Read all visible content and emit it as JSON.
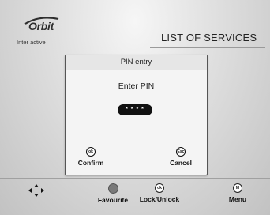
{
  "logo": {
    "name": "Orbit",
    "subtitle": "Inter active"
  },
  "screen_title": "LIST OF SERVICES",
  "dialog": {
    "title": "PIN entry",
    "prompt": "Enter PIN",
    "pin_value": "* * * *",
    "confirm": {
      "key": "ok",
      "label": "Confirm"
    },
    "cancel": {
      "key": "Esc",
      "label": "Cancel"
    }
  },
  "footer": {
    "favourite": {
      "label": "Favourite"
    },
    "lock_unlock": {
      "key": "ok",
      "label": "Lock/Unlock"
    },
    "menu": {
      "key": "M",
      "label": "Menu"
    }
  }
}
